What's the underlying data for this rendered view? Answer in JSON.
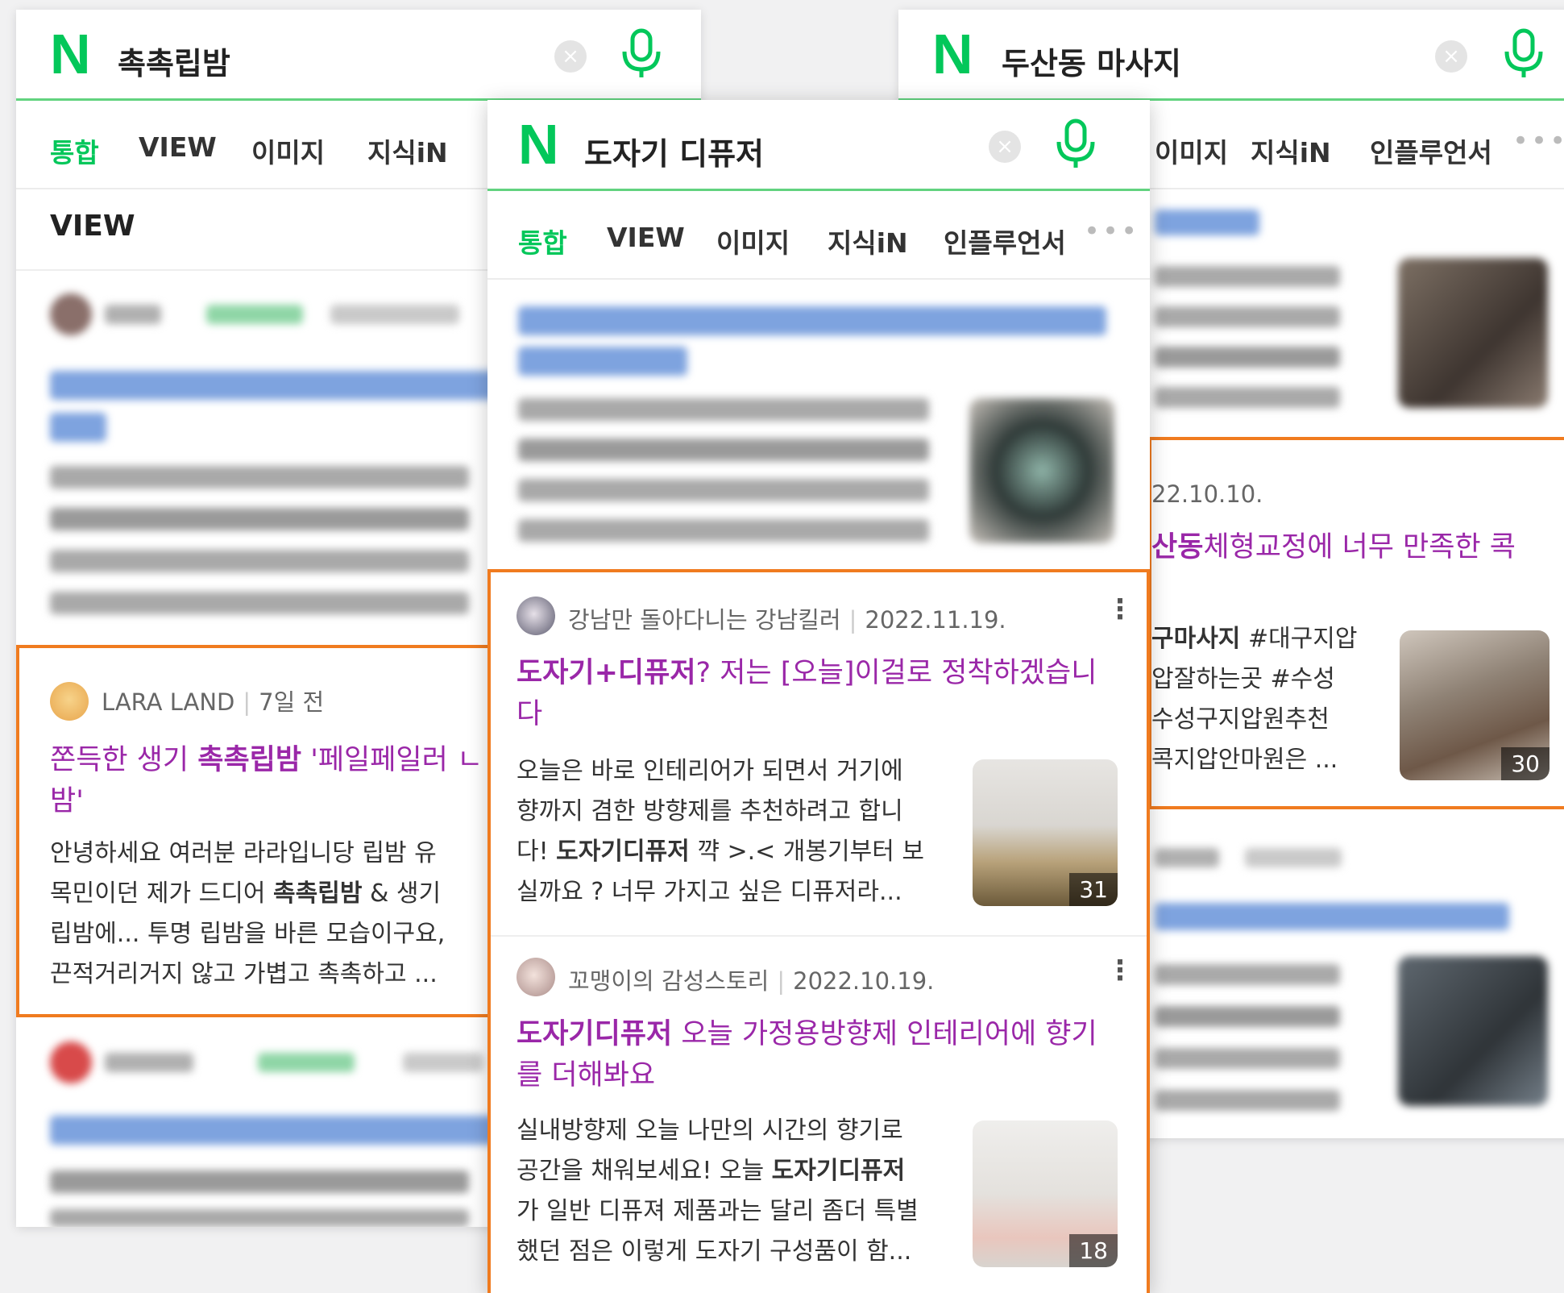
{
  "colors": {
    "naver_green": "#03c75a",
    "title_purple": "#9a27a8",
    "highlight_orange": "#f07b1f"
  },
  "left": {
    "search": {
      "logo": "N",
      "query": "촉촉립밤"
    },
    "tabs": [
      "통합",
      "VIEW",
      "이미지",
      "지식iN"
    ],
    "section_title": "VIEW",
    "post": {
      "author": "LARA LAND",
      "date": "7일 전",
      "title_1": "쫀득한 생기 ",
      "title_bold": "촉촉립밤",
      "title_2": " '페일페일러 ㄴ",
      "title_3": "밤'",
      "desc_1": "안녕하세요 여러분 라라입니당 립밤 유",
      "desc_2a": "목민이던 제가 드디어 ",
      "desc_2b": "촉촉립밤",
      "desc_2c": " & 생기",
      "desc_3": "립밤에... 투명 립밤을 바른 모습이구요,",
      "desc_4": "끈적거리거지 않고 가볍고 촉촉하고 ..."
    }
  },
  "center": {
    "search": {
      "logo": "N",
      "query": "도자기 디퓨저"
    },
    "tabs": [
      "통합",
      "VIEW",
      "이미지",
      "지식iN",
      "인플루언서"
    ],
    "tab_more": "•••",
    "post1": {
      "author": "강남만 돌아다니는 강남킬러",
      "date": "2022.11.19.",
      "title_bold": "도자기+디퓨저",
      "title_rest": "? 저는 [오늘]이걸로 정착하겠습니",
      "title_2": "다",
      "desc_1": "오늘은 바로 인테리어가 되면서 거기에",
      "desc_2": "향까지 겸한 방향제를 추천하려고 합니",
      "desc_3a": "다! ",
      "desc_3b": "도자기디퓨저",
      "desc_3c": " 꺅 >.< 개봉기부터 보",
      "desc_4": "실까요 ? 너무 가지고 싶은 디퓨저라...",
      "image_count": "31"
    },
    "post2": {
      "author": "꼬맹이의 감성스토리",
      "date": "2022.10.19.",
      "title_bold": "도자기디퓨저",
      "title_rest": " 오늘 가정용방향제 인테리어에 향기",
      "title_2": "를 더해봐요",
      "desc_1": "실내방향제 오늘 나만의 시간의 향기로",
      "desc_2a": "공간을 채워보세요! 오늘 ",
      "desc_2b": "도자기디퓨저",
      "desc_3": "가 일반 디퓨져 제품과는 달리 좀더 특별",
      "desc_4": "했던 점은 이렇게 도자기 구성품이 함...",
      "image_count": "18"
    }
  },
  "right": {
    "search": {
      "logo": "N",
      "query": "두산동 마사지"
    },
    "tabs": [
      "이미지",
      "지식iN",
      "인플루언서"
    ],
    "tab_more": "•••",
    "post": {
      "date": "22.10.10.",
      "title_bold": "산동",
      "title_rest": "체형교정에 너무 만족한 콕",
      "desc_1a": "구마사지",
      "desc_1b": " #대구지압",
      "desc_2": "압잘하는곳 #수성",
      "desc_3": "수성구지압원추천",
      "desc_4": "콕지압안마원은 ...",
      "image_count": "30"
    }
  }
}
